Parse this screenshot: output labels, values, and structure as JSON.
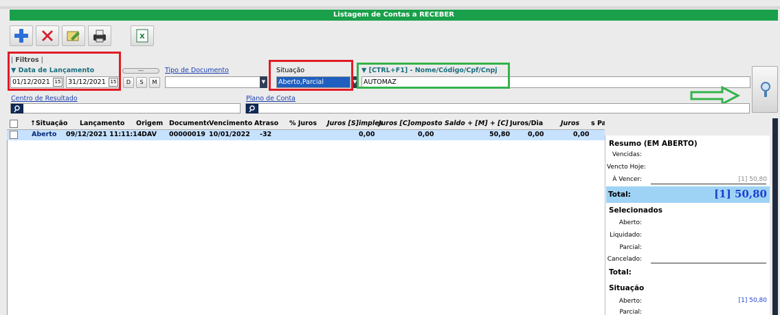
{
  "window": {
    "title": "Listagem de Contas a RECEBER"
  },
  "toolbar": {
    "buttons": [
      {
        "name": "add",
        "icon": "plus-icon"
      },
      {
        "name": "delete",
        "icon": "x-icon"
      },
      {
        "name": "edit",
        "icon": "edit-icon"
      },
      {
        "name": "print",
        "icon": "printer-icon"
      },
      {
        "name": "export",
        "icon": "excel-icon"
      }
    ]
  },
  "filters": {
    "group_label": "Filtros",
    "date_label": "▼ Data de Lançamento",
    "date_from": "01/12/2021",
    "date_to": "31/12/2021",
    "cal_icon": "15",
    "period_buttons": [
      "D",
      "S",
      "M"
    ],
    "range_slider": "---",
    "doc_type_label": "Tipo de Documento",
    "doc_type_value": "",
    "situacao_label": "Situação",
    "situacao_value": "Aberto,Parcial",
    "name_label": "▼ [CTRL+F1] - Nome/Código/Cpf/Cnpj",
    "name_value": "AUTOMAZ",
    "centro_label": "Centro de Resultado",
    "centro_value": "",
    "plano_label": "Plano de Conta",
    "plano_value": ""
  },
  "grid": {
    "columns": [
      "↑Situação",
      "Lançamento",
      "Origem",
      "Documento",
      "Vencimento",
      "Atraso",
      "% Juros",
      "Juros [S]imples",
      "Juros [C]omposto",
      "Saldo + [M] + [C]",
      "Juros/Dia",
      "Juros",
      "s Pa"
    ],
    "rows": [
      {
        "situacao": "Aberto",
        "lancamento": "09/12/2021 11:11:14",
        "origem": "DAV",
        "documento": "00000019",
        "vencimento": "10/01/2022",
        "atraso": "-32",
        "juros_simples": "0,00",
        "juros_composto": "0,00",
        "saldo": "50,80",
        "juros_dia": "0,00",
        "juros": "0,00"
      }
    ]
  },
  "summary": {
    "title": "Resumo (EM ABERTO)",
    "vencidas": "Vencidas:",
    "vencto_hoje": "Vencto Hoje:",
    "a_vencer": "À Vencer:",
    "a_vencer_value": "[1] 50,80",
    "total_label": "Total:",
    "total_value": "[1] 50,80",
    "selecionados_title": "Selecionados",
    "aberto": "Aberto:",
    "liquidado": "Liquidado:",
    "parcial": "Parcial:",
    "cancelado": "Cancelado:",
    "sel_total": "Total:",
    "situacao_title": "Situação",
    "sit_aberto": "Aberto:",
    "sit_aberto_value": "[1] 50,80",
    "sit_parcial": "Parcial:"
  },
  "colors": {
    "title_bar": "#1aa04a",
    "highlight_row": "#c7e2ff",
    "annotation_red": "#e01b24",
    "annotation_green": "#34b34a",
    "total_band": "#9fd3f5",
    "total_value": "#1a3fd0"
  }
}
